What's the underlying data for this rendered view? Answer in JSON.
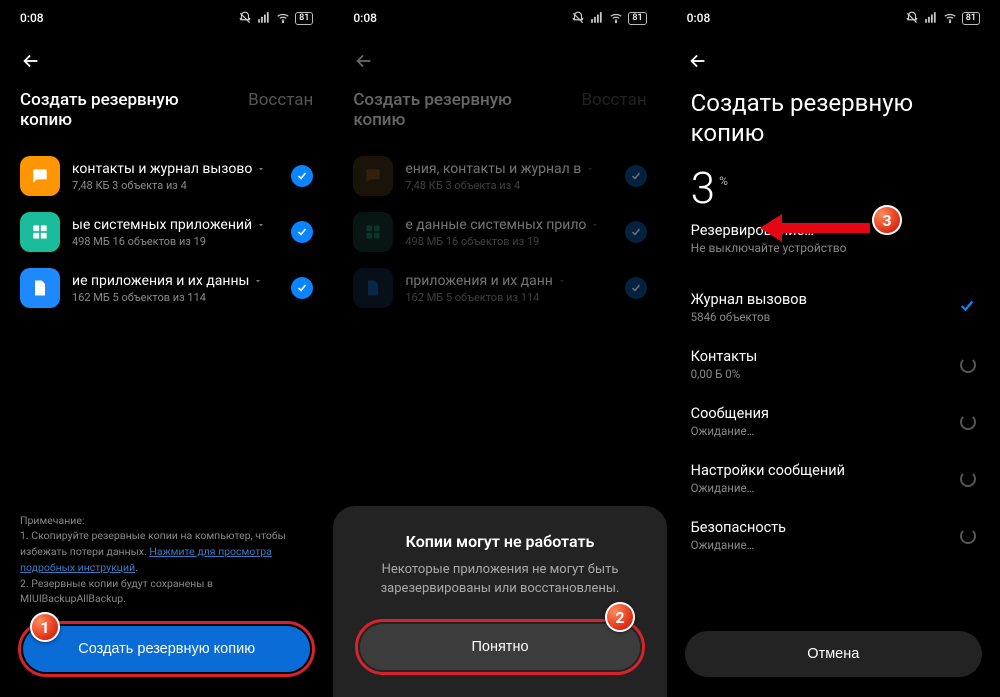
{
  "status": {
    "time": "0:08",
    "battery": "81"
  },
  "tabs": {
    "backup": "Создать резервную копию",
    "restore": "Восстан"
  },
  "items": [
    {
      "title": "контакты и журнал вызово",
      "sub": "7,48 КБ  3 объекта из 4"
    },
    {
      "title": "ые системных приложений",
      "sub": "498 МБ  16 объектов из 19"
    },
    {
      "title": "ие приложения и их данны",
      "sub": "162 МБ  5 объектов из 114"
    }
  ],
  "items2": [
    {
      "title": "ения, контакты и журнал в",
      "sub": "7,48 КБ  3 объекта из 4"
    },
    {
      "title": "е данные системных прило",
      "sub": "498 МБ  16 объектов из 19"
    },
    {
      "title": "приложения и их данн",
      "sub": "162 МБ  5 объектов из 114"
    }
  ],
  "note": {
    "heading": "Примечание:",
    "line1a": "1. Скопируйте резервные копии на компьютер, чтобы избежать потери данных. ",
    "link": "Нажмите для просмотра подробных инструкций",
    "dot": ".",
    "line2": "2. Резервные копии будут сохранены в MIUIBackupAllBackup."
  },
  "btn": {
    "create": "Создать резервную копию",
    "ok": "Понятно",
    "cancel": "Отмена"
  },
  "sheet": {
    "title": "Копии могут не работать",
    "text": "Некоторые приложения не могут быть зарезервированы или восстановлены."
  },
  "s3": {
    "title": "Создать резервную копию",
    "percent": "3",
    "unit": "%",
    "status": "Резервирование…",
    "warn": "Не выключайте устройство",
    "rows": [
      {
        "title": "Журнал вызовов",
        "sub": "5846 объектов",
        "state": "done"
      },
      {
        "title": "Контакты",
        "sub": "0,00 Б 0%",
        "state": "spin"
      },
      {
        "title": "Сообщения",
        "sub": "Ожидание…",
        "state": "spin"
      },
      {
        "title": "Настройки сообщений",
        "sub": "Ожидание…",
        "state": "spin"
      },
      {
        "title": "Безопасность",
        "sub": "Ожидание…",
        "state": "spin"
      }
    ]
  },
  "badges": {
    "b1": "1",
    "b2": "2",
    "b3": "3"
  }
}
